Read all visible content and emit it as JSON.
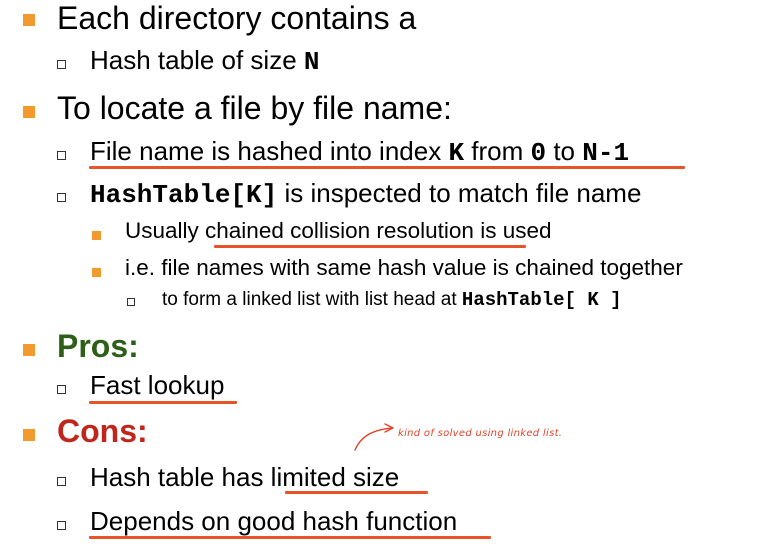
{
  "bullets": {
    "directory_heading": "Each directory contains a",
    "hash_table_size_prefix": "Hash table of size ",
    "hash_table_size_var": "N",
    "locate_heading": "To locate a file by file name:",
    "hashed_prefix": "File name is hashed into index ",
    "hashed_k": "K",
    "hashed_from": " from ",
    "hashed_zero": "0",
    "hashed_to": " to ",
    "hashed_n1": "N-1",
    "inspected_code": "HashTable[K]",
    "inspected_suffix": " is inspected to match file name",
    "usually_prefix": "Usually ",
    "usually_link": "chained collision resolution",
    "usually_suffix": " is used",
    "ie_text": "i.e. file names with same hash value is chained together",
    "form_prefix": "to form a linked list with list head at ",
    "form_code": "HashTable[ K ]",
    "pros_heading": "Pros:",
    "fast_lookup": "Fast lookup",
    "cons_heading": "Cons:",
    "limited_prefix": "Hash table has ",
    "limited_text": "limited size",
    "depends_text": "Depends on good hash function"
  },
  "annotation": {
    "handwritten_note": "kind of solved using linked list."
  },
  "colors": {
    "bullet_orange": "#f29a2e",
    "underline_red": "#e8542a",
    "pros_green": "#2e5f19",
    "cons_red": "#c0261b"
  }
}
